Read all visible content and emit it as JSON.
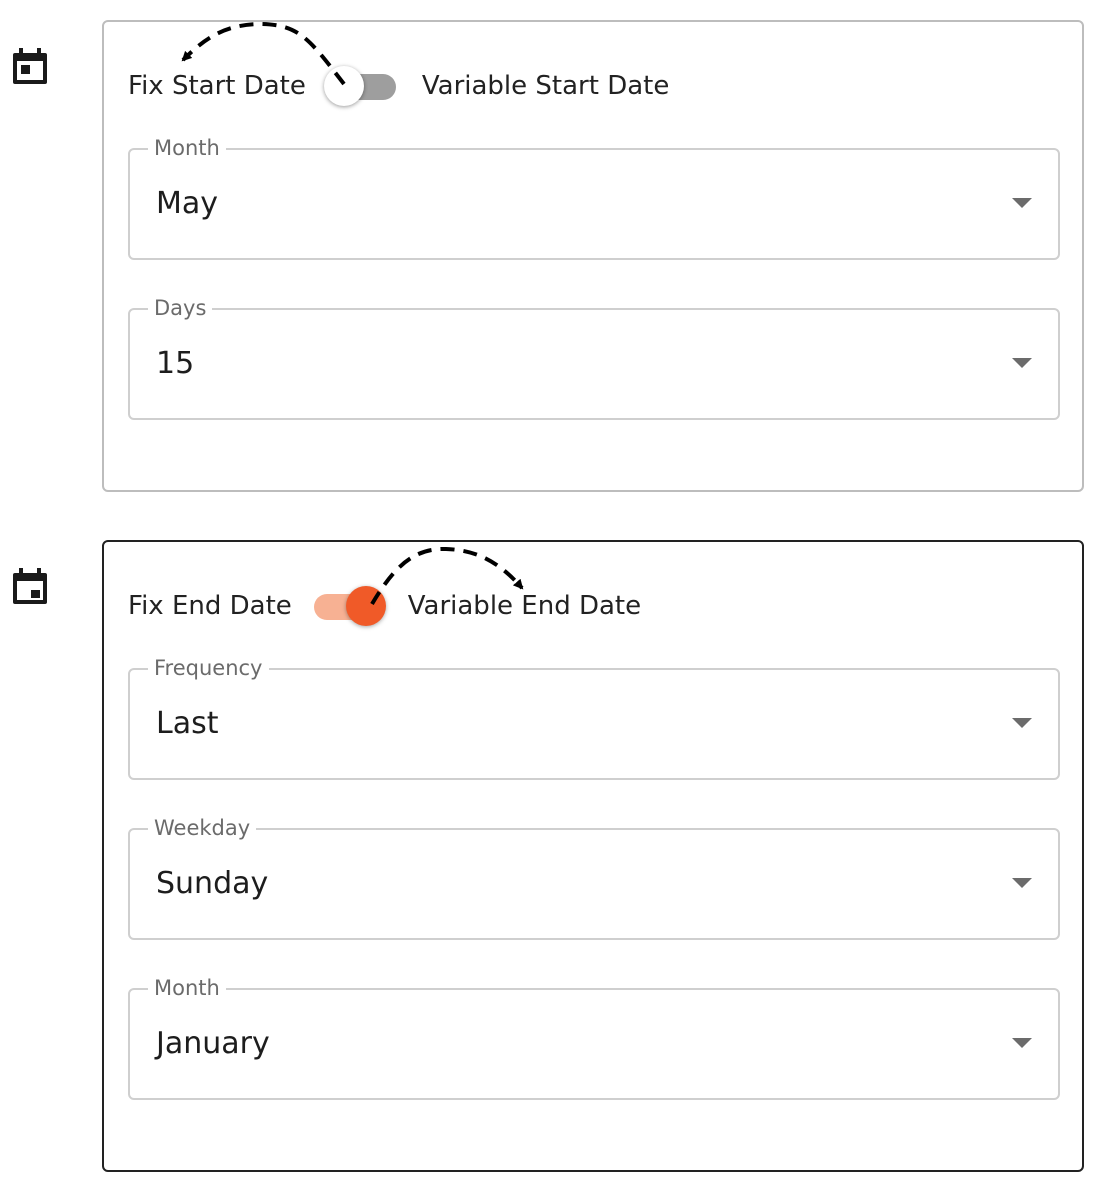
{
  "start_section": {
    "fix_label": "Fix Start Date",
    "variable_label": "Variable Start Date",
    "toggle_on": false,
    "fields": [
      {
        "label": "Month",
        "value": "May"
      },
      {
        "label": "Days",
        "value": "15"
      }
    ]
  },
  "end_section": {
    "fix_label": "Fix End Date",
    "variable_label": "Variable End Date",
    "toggle_on": true,
    "fields": [
      {
        "label": "Frequency",
        "value": "Last"
      },
      {
        "label": "Weekday",
        "value": "Sunday"
      },
      {
        "label": "Month",
        "value": "January"
      }
    ]
  },
  "icons": {
    "section_icon": "calendar-icon",
    "select_icon": "caret-down-icon"
  },
  "colors": {
    "toggle_active": "#f05a28",
    "toggle_active_track": "#f7b193",
    "toggle_inactive_track": "#9e9e9e",
    "annotation_arrow": "#000000"
  }
}
